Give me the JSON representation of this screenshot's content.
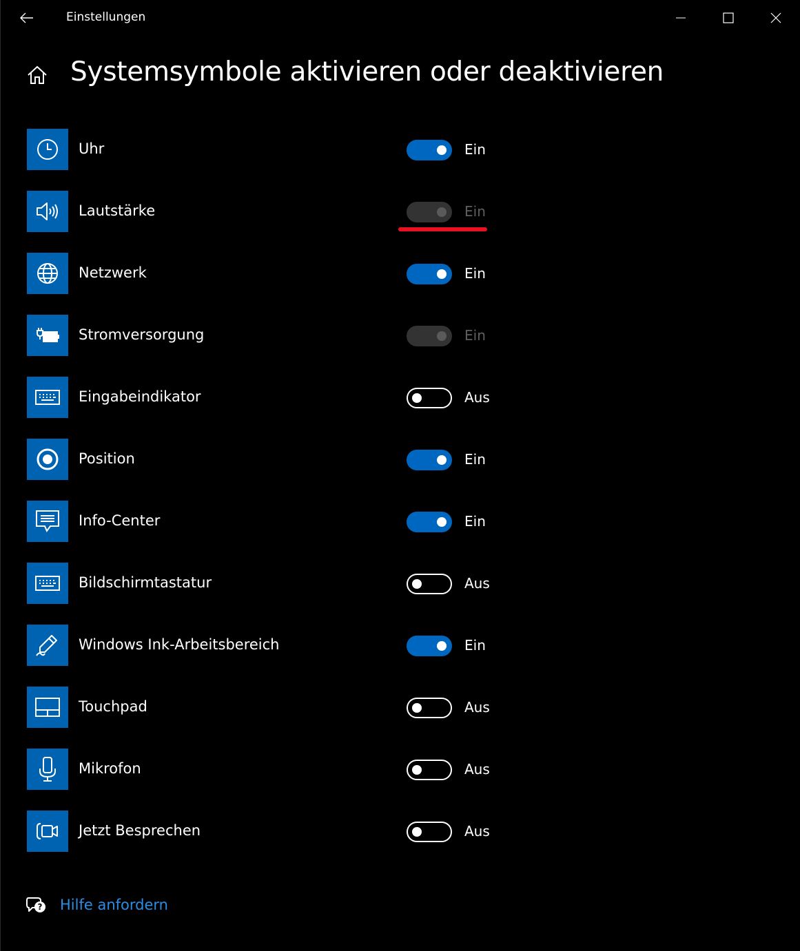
{
  "window": {
    "title": "Einstellungen",
    "back_icon": "back-arrow-icon",
    "controls": [
      "minimize-icon",
      "maximize-icon",
      "close-icon"
    ]
  },
  "header": {
    "home_icon": "home-icon",
    "title": "Systemsymbole aktivieren oder deaktivieren"
  },
  "colors": {
    "accent": "#0063b1",
    "toggle_on": "#0067c0",
    "disabled": "#333333",
    "link": "#2a8ee6",
    "annotation": "#e81123"
  },
  "items": [
    {
      "label": "Uhr",
      "icon": "clock-icon",
      "state": "Ein",
      "toggle": "on"
    },
    {
      "label": "Lautstärke",
      "icon": "volume-icon",
      "state": "Ein",
      "toggle": "disabled"
    },
    {
      "label": "Netzwerk",
      "icon": "globe-icon",
      "state": "Ein",
      "toggle": "on"
    },
    {
      "label": "Stromversorgung",
      "icon": "battery-plug-icon",
      "state": "Ein",
      "toggle": "disabled"
    },
    {
      "label": "Eingabeindikator",
      "icon": "keyboard-icon",
      "state": "Aus",
      "toggle": "off"
    },
    {
      "label": "Position",
      "icon": "location-icon",
      "state": "Ein",
      "toggle": "on"
    },
    {
      "label": "Info-Center",
      "icon": "action-center-icon",
      "state": "Ein",
      "toggle": "on"
    },
    {
      "label": "Bildschirmtastatur",
      "icon": "keyboard-icon",
      "state": "Aus",
      "toggle": "off"
    },
    {
      "label": "Windows Ink-Arbeitsbereich",
      "icon": "pen-icon",
      "state": "Ein",
      "toggle": "on"
    },
    {
      "label": "Touchpad",
      "icon": "touchpad-icon",
      "state": "Aus",
      "toggle": "off"
    },
    {
      "label": "Mikrofon",
      "icon": "microphone-icon",
      "state": "Aus",
      "toggle": "off"
    },
    {
      "label": "Jetzt Besprechen",
      "icon": "meet-now-icon",
      "state": "Aus",
      "toggle": "off"
    }
  ],
  "help": {
    "icon": "help-chat-icon",
    "label": "Hilfe anfordern"
  }
}
